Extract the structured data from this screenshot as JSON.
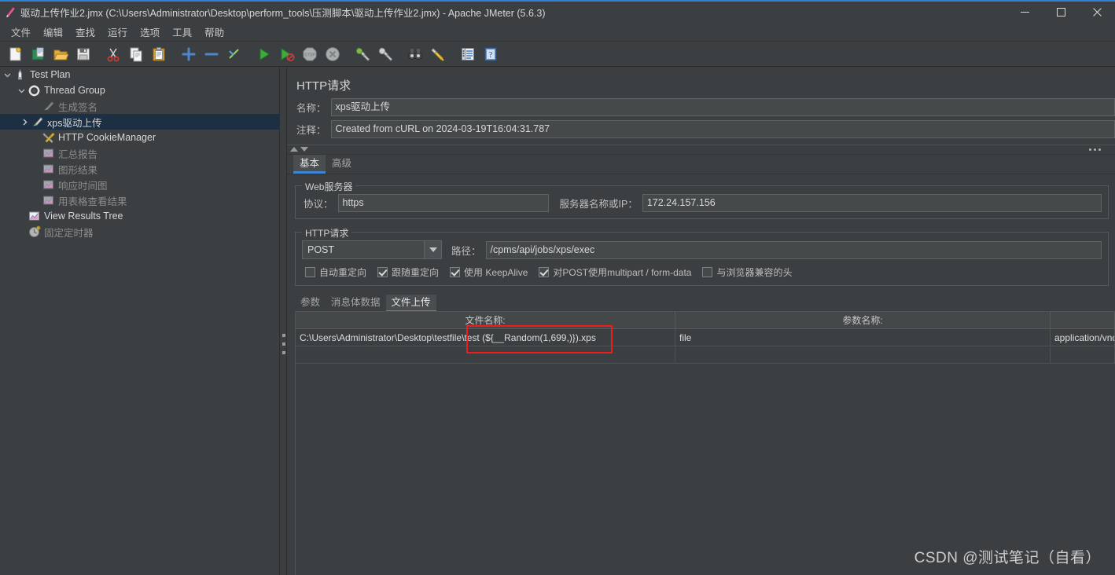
{
  "window": {
    "title": "驱动上传作业2.jmx (C:\\Users\\Administrator\\Desktop\\perform_tools\\压测脚本\\驱动上传作业2.jmx) - Apache JMeter (5.6.3)",
    "app_icon": "jmeter-feather-icon",
    "controls": {
      "minimize": "minimize-icon",
      "maximize": "maximize-icon",
      "close": "close-icon"
    },
    "accent_color": "#2f7fd4",
    "background_color": "#3c3f41"
  },
  "menubar": {
    "items": [
      {
        "label": "文件"
      },
      {
        "label": "编辑"
      },
      {
        "label": "查找"
      },
      {
        "label": "运行"
      },
      {
        "label": "选项"
      },
      {
        "label": "工具"
      },
      {
        "label": "帮助"
      }
    ]
  },
  "toolbar": {
    "buttons": [
      {
        "icon": "new-file-icon",
        "name": "new-button"
      },
      {
        "icon": "templates-icon",
        "name": "templates-button"
      },
      {
        "icon": "open-folder-icon",
        "name": "open-button"
      },
      {
        "icon": "save-disk-icon",
        "name": "save-button"
      },
      {
        "sep": true
      },
      {
        "icon": "scissors-cut-icon",
        "name": "cut-button"
      },
      {
        "icon": "copy-icon",
        "name": "copy-button"
      },
      {
        "icon": "clipboard-paste-icon",
        "name": "paste-button"
      },
      {
        "sep": true
      },
      {
        "icon": "plus-expand-icon",
        "name": "expand-all-button"
      },
      {
        "icon": "minus-collapse-icon",
        "name": "collapse-all-button"
      },
      {
        "icon": "toggle-icon",
        "name": "toggle-button"
      },
      {
        "sep": true
      },
      {
        "icon": "play-start-icon",
        "name": "start-button"
      },
      {
        "icon": "play-no-timers-icon",
        "name": "start-no-pauses-button"
      },
      {
        "icon": "stop-sign-icon",
        "name": "stop-button"
      },
      {
        "icon": "shutdown-icon",
        "name": "shutdown-button"
      },
      {
        "sep": true
      },
      {
        "icon": "broom-clear-icon",
        "name": "clear-button"
      },
      {
        "icon": "broom-clear-all-icon",
        "name": "clear-all-button"
      },
      {
        "sep": true
      },
      {
        "icon": "binoculars-search-icon",
        "name": "search-button"
      },
      {
        "icon": "brush-reset-icon",
        "name": "reset-search-button"
      },
      {
        "sep": true
      },
      {
        "icon": "function-helper-icon",
        "name": "function-helper-button"
      },
      {
        "icon": "help-question-icon",
        "name": "help-button"
      }
    ]
  },
  "tree": {
    "nodes": [
      {
        "label": "Test Plan",
        "icon": "test-plan-icon",
        "indent": 0,
        "toggle": "expanded",
        "dim": false,
        "selected": false
      },
      {
        "label": "Thread Group",
        "icon": "thread-group-icon",
        "indent": 1,
        "toggle": "expanded",
        "dim": false,
        "selected": false
      },
      {
        "label": "生成签名",
        "icon": "http-sampler-icon",
        "indent": 2,
        "toggle": "none",
        "dim": true,
        "selected": false
      },
      {
        "label": "xps驱动上传",
        "icon": "http-sampler-icon",
        "indent": 2,
        "toggle": "collapsed",
        "dim": false,
        "selected": true
      },
      {
        "label": "HTTP CookieManager",
        "icon": "cookie-manager-icon",
        "indent": 2,
        "toggle": "none",
        "dim": false,
        "selected": false
      },
      {
        "label": "汇总报告",
        "icon": "listener-icon",
        "indent": 2,
        "toggle": "none",
        "dim": true,
        "selected": false
      },
      {
        "label": "图形结果",
        "icon": "listener-icon",
        "indent": 2,
        "toggle": "none",
        "dim": true,
        "selected": false
      },
      {
        "label": "响应时间图",
        "icon": "listener-icon",
        "indent": 2,
        "toggle": "none",
        "dim": true,
        "selected": false
      },
      {
        "label": "用表格查看结果",
        "icon": "listener-icon",
        "indent": 2,
        "toggle": "none",
        "dim": true,
        "selected": false
      },
      {
        "label": "View Results Tree",
        "icon": "listener-icon",
        "indent": 1,
        "toggle": "none",
        "dim": false,
        "selected": false
      },
      {
        "label": "固定定时器",
        "icon": "timer-icon",
        "indent": 1,
        "toggle": "none",
        "dim": true,
        "selected": false
      }
    ]
  },
  "panel": {
    "title": "HTTP请求",
    "name_label": "名称：",
    "name_value": "xps驱动上传",
    "comment_label": "注释：",
    "comment_value": "Created from cURL on 2024-03-19T16:04:31.787",
    "tabs": [
      {
        "label": "基本",
        "active": true
      },
      {
        "label": "高级",
        "active": false
      }
    ],
    "webserver": {
      "legend": "Web服务器",
      "protocol_label": "协议：",
      "protocol_value": "https",
      "host_label": "服务器名称或IP：",
      "host_value": "172.24.157.156"
    },
    "httprequest": {
      "legend": "HTTP请求",
      "method_value": "POST",
      "method_arrow": "chevron-down-icon",
      "path_label": "路径：",
      "path_value": "/cpms/api/jobs/xps/exec",
      "checkboxes": [
        {
          "label": "自动重定向",
          "checked": false
        },
        {
          "label": "跟随重定向",
          "checked": true
        },
        {
          "label": "使用 KeepAlive",
          "checked": true
        },
        {
          "label": "对POST使用multipart / form-data",
          "checked": true
        },
        {
          "label": "与浏览器兼容的头",
          "checked": false
        }
      ]
    },
    "subtabs": [
      {
        "label": "参数",
        "active": false
      },
      {
        "label": "消息体数据",
        "active": false
      },
      {
        "label": "文件上传",
        "active": true
      }
    ],
    "file_table": {
      "headers": [
        "文件名称:",
        "参数名称:",
        ""
      ],
      "rows": [
        {
          "cells": [
            "C:\\Users\\Administrator\\Desktop\\testfile\\test (${__Random(1,699,)}).xps",
            "file",
            "application/vnd"
          ]
        }
      ],
      "empty_rows": 1
    }
  },
  "annotation": {
    "color": "#ee1c1c",
    "target": "filename-cell-random-function"
  },
  "watermark": {
    "text": "CSDN @测试笔记（自看）"
  }
}
